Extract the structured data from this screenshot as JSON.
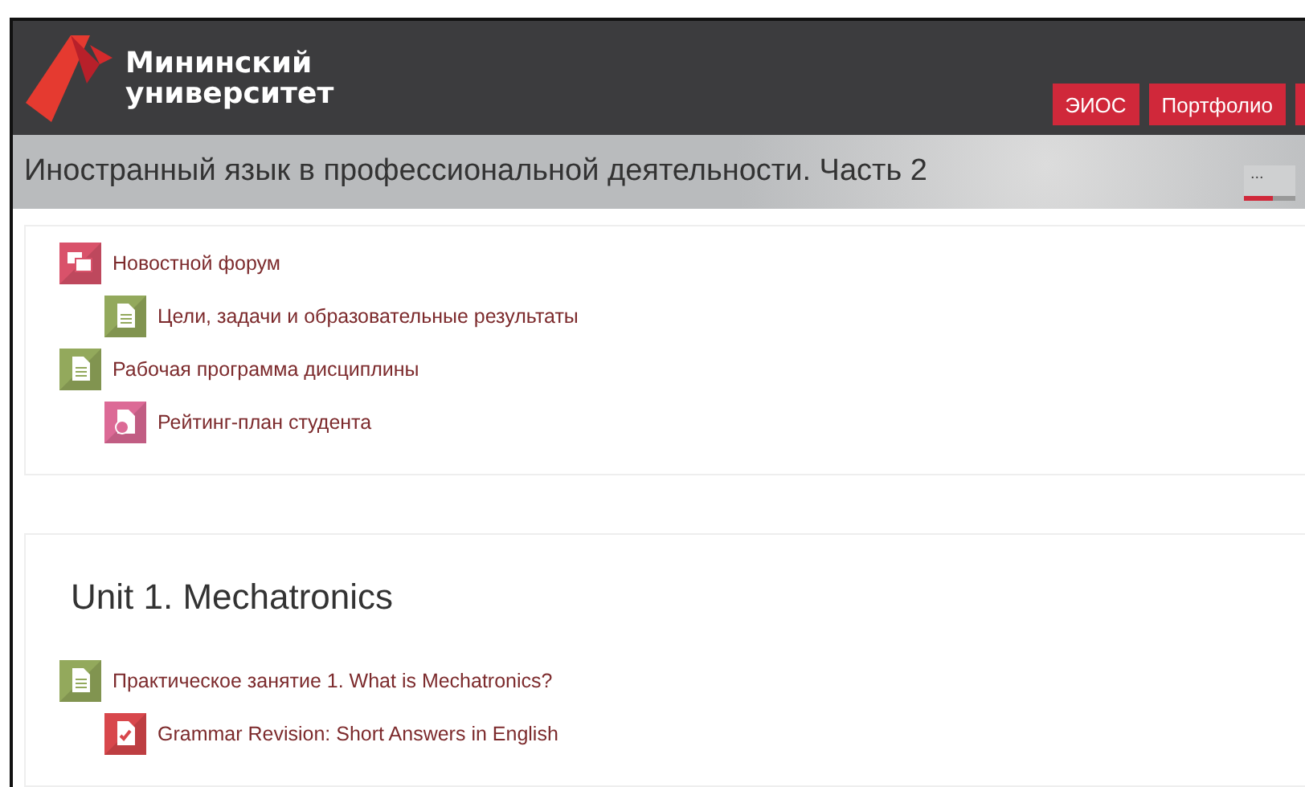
{
  "header": {
    "logo_lines": [
      "Мининский",
      "университет"
    ],
    "buttons": [
      {
        "label": "ЭИОС"
      },
      {
        "label": "Портфолио"
      }
    ],
    "clipped_button": true
  },
  "banner": {
    "title": "Иностранный язык в профессиональной деятельности. Часть 2",
    "menu": {
      "label": "...",
      "level": 0.55
    }
  },
  "sections": [
    {
      "items": [
        {
          "kind": "forum",
          "label": "Новостной форум",
          "children": [
            {
              "kind": "page",
              "label": "Цели, задачи и образовательные результаты"
            }
          ]
        },
        {
          "kind": "page",
          "label": "Рабочая программа дисциплины",
          "children": [
            {
              "kind": "file",
              "label": "Рейтинг-план студента"
            }
          ]
        }
      ]
    },
    {
      "title": "Unit 1. Mechatronics",
      "items": [
        {
          "kind": "page",
          "label": "Практическое занятие 1. What is Mechatronics?",
          "children": [
            {
              "kind": "quiz",
              "label": "Grammar Revision: Short Answers in English"
            }
          ]
        }
      ]
    }
  ]
}
